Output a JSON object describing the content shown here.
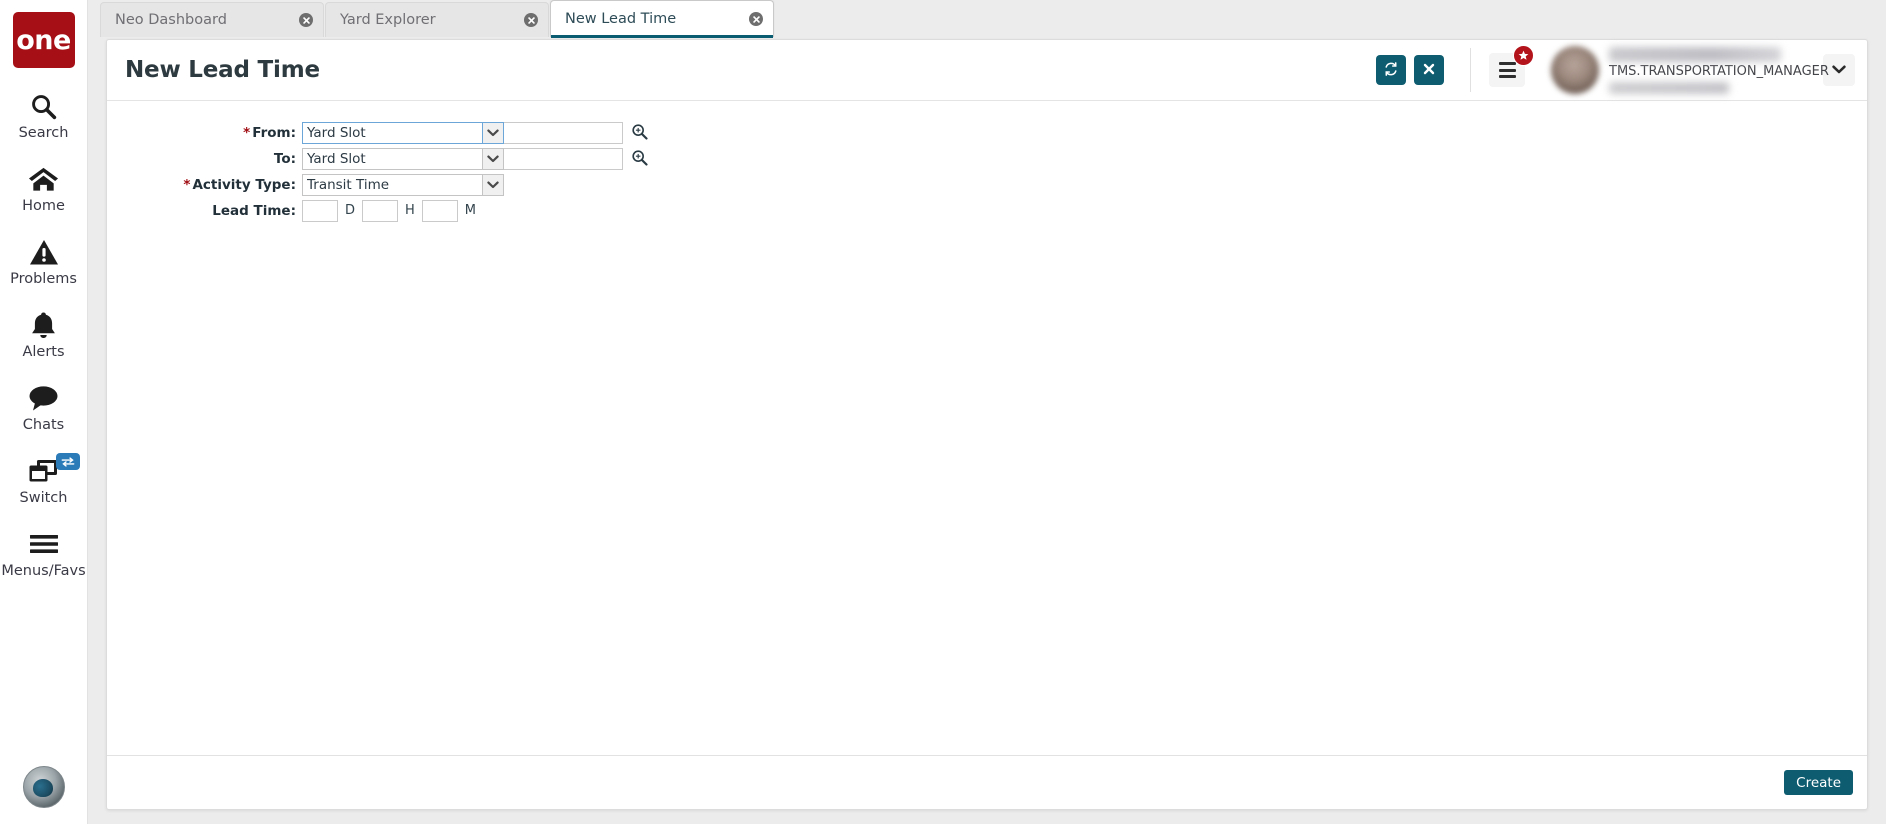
{
  "app": {
    "logo_text": "one",
    "colors": {
      "brand_red": "#a50f15",
      "teal": "#0d5c70",
      "accent_blue": "#2b7bb9",
      "badge_red": "#b3131b"
    }
  },
  "sidebar": {
    "items": [
      {
        "label": "Search",
        "icon": "search-icon"
      },
      {
        "label": "Home",
        "icon": "home-icon"
      },
      {
        "label": "Problems",
        "icon": "warning-triangle-icon"
      },
      {
        "label": "Alerts",
        "icon": "bell-icon"
      },
      {
        "label": "Chats",
        "icon": "chat-bubble-icon"
      },
      {
        "label": "Switch",
        "icon": "windows-stack-icon",
        "badge_icon": "swap-arrows-icon"
      },
      {
        "label": "Menus/Favs",
        "icon": "hamburger-icon"
      }
    ]
  },
  "tabs": [
    {
      "label": "Neo Dashboard",
      "active": false
    },
    {
      "label": "Yard Explorer",
      "active": false
    },
    {
      "label": "New Lead Time",
      "active": true
    }
  ],
  "header": {
    "title": "New Lead Time",
    "refresh_icon": "refresh-icon",
    "close_icon": "close-x-icon",
    "menu_icon": "hamburger-menu-icon",
    "favorites_badge_icon": "star-icon",
    "user": {
      "name": "",
      "role": "TMS.TRANSPORTATION_MANAGER",
      "sub": "",
      "avatar_icon": "user-avatar",
      "caret_icon": "chevron-down-icon"
    }
  },
  "form": {
    "rows": [
      {
        "label": "From:",
        "required": true,
        "select_value": "Yard Slot",
        "text_value": "",
        "has_lookup": true,
        "focused": true
      },
      {
        "label": "To:",
        "required": false,
        "select_value": "Yard Slot",
        "text_value": "",
        "has_lookup": true,
        "focused": false
      },
      {
        "label": "Activity Type:",
        "required": true,
        "select_value": "Transit Time",
        "text_value": null,
        "has_lookup": false,
        "focused": false
      }
    ],
    "lead_time": {
      "label": "Lead Time:",
      "required": false,
      "days_value": "",
      "days_unit": "D",
      "hours_value": "",
      "hours_unit": "H",
      "minutes_value": "",
      "minutes_unit": "M"
    },
    "lookup_icon": "magnifier-icon",
    "dropdown_icon": "chevron-down-icon"
  },
  "footer": {
    "create_label": "Create"
  }
}
